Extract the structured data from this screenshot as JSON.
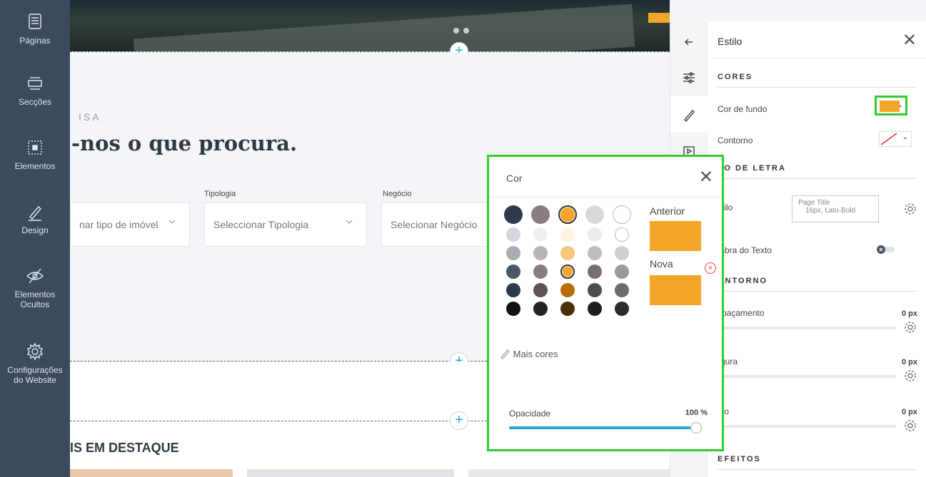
{
  "sidebar": {
    "items": [
      {
        "label": "Páginas",
        "icon": "pages-icon"
      },
      {
        "label": "Secções",
        "icon": "sections-icon"
      },
      {
        "label": "Elementos",
        "icon": "elements-icon"
      },
      {
        "label": "Design",
        "icon": "pencil-icon"
      },
      {
        "label_line1": "Elementos",
        "label_line2": "Ocultos",
        "icon": "eye-slash-icon"
      },
      {
        "label_line1": "Configurações",
        "label_line2": "do Website",
        "icon": "gear-icon"
      }
    ]
  },
  "canvas": {
    "kicker": "ISA",
    "headline": "-nos o que procura.",
    "filters": [
      {
        "label": "",
        "placeholder": "nar tipo de imóvel"
      },
      {
        "label": "Tipologia",
        "placeholder": "Seleccionar Tipologia"
      },
      {
        "label": "Negócio",
        "placeholder": "Selecionar Negócio"
      }
    ],
    "featured_title": "IS EM DESTAQUE"
  },
  "panel": {
    "title": "Estilo",
    "sections": {
      "cores": "CORES",
      "tipo_letra": "PO DE LETRA",
      "contorno": "ONTORNO",
      "efeitos": "EFEITOS"
    },
    "cor_de_fundo": "Cor de fundo",
    "contorno_label": "Contorno",
    "estilo_label": "stilo",
    "estilo_value": "Page Title",
    "estilo_sub": "16px, Lato-Bold",
    "sombra": "mbra do Texto",
    "espacamento": "spaçamento",
    "largura": "rgura",
    "raio": "aio",
    "px_value": "0 px",
    "bg_color": "#f4a62a"
  },
  "popup": {
    "title": "Cor",
    "anterior": "Anterior",
    "nova": "Nova",
    "mais_cores": "Mais cores",
    "opacidade": "Opacidade",
    "opacidade_value": "100 %",
    "opacity_fraction": 1.0,
    "swatches": [
      [
        "#2e3a4a",
        "#8a7d7d",
        "#f4a62a",
        "#d9d9d9",
        "#ffffff"
      ],
      [
        "#d3d7de",
        "#f0eeec",
        "#fdf3e2",
        "#ececec",
        "#ffffff"
      ],
      [
        "#a7acb5",
        "#bab5b5",
        "#f7c77a",
        "#bdbdbd",
        "#cfcfcf"
      ],
      [
        "#4a5568",
        "#8a7d7d",
        "#f4a62a",
        "#7a6f6f",
        "#9a9a9a"
      ],
      [
        "#2e3a4a",
        "#5e5252",
        "#b86d0a",
        "#4d4d4d",
        "#6b6b6b"
      ],
      [
        "#111111",
        "#222222",
        "#4a2e04",
        "#1e1e1e",
        "#2b2b2b"
      ]
    ],
    "previous_color": "#f4a62a",
    "new_color": "#f4a62a"
  }
}
